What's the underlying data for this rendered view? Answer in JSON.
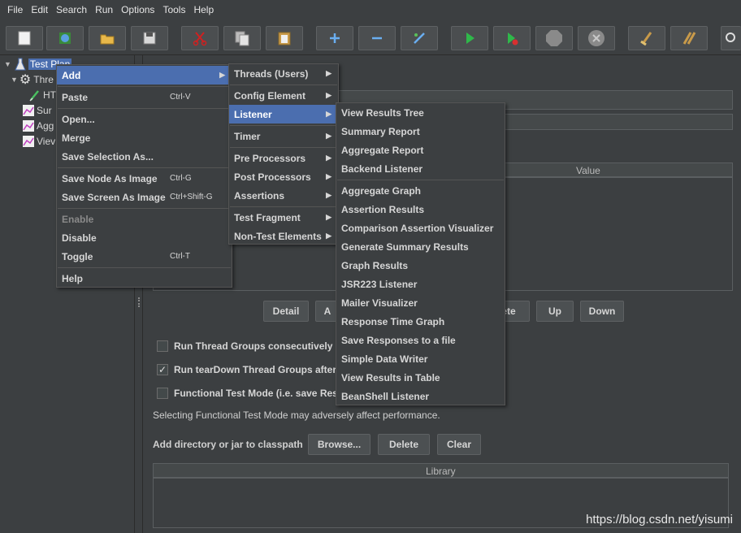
{
  "menubar": {
    "items": [
      {
        "label": "File"
      },
      {
        "label": "Edit"
      },
      {
        "label": "Search"
      },
      {
        "label": "Run"
      },
      {
        "label": "Options"
      },
      {
        "label": "Tools"
      },
      {
        "label": "Help"
      }
    ]
  },
  "toolbar": {
    "buttons": [
      {
        "icon": "new-icon"
      },
      {
        "icon": "templates-icon"
      },
      {
        "icon": "open-icon"
      },
      {
        "icon": "save-icon"
      },
      {
        "icon": "cut-icon"
      },
      {
        "icon": "copy-icon"
      },
      {
        "icon": "paste-icon"
      },
      {
        "icon": "expand-icon"
      },
      {
        "icon": "collapse-icon"
      },
      {
        "icon": "toggle-icon"
      },
      {
        "icon": "start-icon"
      },
      {
        "icon": "start-no-pauses-icon"
      },
      {
        "icon": "stop-icon"
      },
      {
        "icon": "shutdown-icon"
      },
      {
        "icon": "clear-icon"
      },
      {
        "icon": "clear-all-icon"
      },
      {
        "icon": "search-icon"
      }
    ]
  },
  "tree": {
    "items": [
      {
        "label": "Test Plan",
        "icon": "flask-icon"
      },
      {
        "label": "Thre",
        "icon": "gear-icon"
      },
      {
        "label": "HT",
        "icon": "pipette-icon"
      },
      {
        "label": "Sur",
        "icon": "graph-icon"
      },
      {
        "label": "Agg",
        "icon": "graph-icon"
      },
      {
        "label": "Viev",
        "icon": "graph-icon"
      }
    ]
  },
  "context_menu": {
    "items": [
      {
        "label": "Add",
        "shortcut": ""
      },
      {
        "label": "Paste",
        "shortcut": "Ctrl-V"
      },
      {
        "label": "Open...",
        "shortcut": ""
      },
      {
        "label": "Merge",
        "shortcut": ""
      },
      {
        "label": "Save Selection As...",
        "shortcut": ""
      },
      {
        "label": "Save Node As Image",
        "shortcut": "Ctrl-G"
      },
      {
        "label": "Save Screen As Image",
        "shortcut": "Ctrl+Shift-G"
      },
      {
        "label": "Enable",
        "shortcut": ""
      },
      {
        "label": "Disable",
        "shortcut": ""
      },
      {
        "label": "Toggle",
        "shortcut": "Ctrl-T"
      },
      {
        "label": "Help",
        "shortcut": ""
      }
    ]
  },
  "add_submenu": {
    "items": [
      {
        "label": "Threads (Users)"
      },
      {
        "label": "Config Element"
      },
      {
        "label": "Listener"
      },
      {
        "label": "Timer"
      },
      {
        "label": "Pre Processors"
      },
      {
        "label": "Post Processors"
      },
      {
        "label": "Assertions"
      },
      {
        "label": "Test Fragment"
      },
      {
        "label": "Non-Test Elements"
      }
    ]
  },
  "listener_submenu": {
    "items": [
      {
        "label": "View Results Tree"
      },
      {
        "label": "Summary Report"
      },
      {
        "label": "Aggregate Report"
      },
      {
        "label": "Backend Listener"
      },
      {
        "label": "Aggregate Graph"
      },
      {
        "label": "Assertion Results"
      },
      {
        "label": "Comparison Assertion Visualizer"
      },
      {
        "label": "Generate Summary Results"
      },
      {
        "label": "Graph Results"
      },
      {
        "label": "JSR223 Listener"
      },
      {
        "label": "Mailer Visualizer"
      },
      {
        "label": "Response Time Graph"
      },
      {
        "label": "Save Responses to a file"
      },
      {
        "label": "Simple Data Writer"
      },
      {
        "label": "View Results in Table"
      },
      {
        "label": "BeanShell Listener"
      }
    ]
  },
  "variables_table": {
    "value_header": "Value"
  },
  "table_buttons": {
    "detail": "Detail",
    "add_partial": "A",
    "delete_partial": "ete",
    "up": "Up",
    "down": "Down"
  },
  "options": {
    "run_consecutively": "Run Thread Groups consecutively (i",
    "run_teardown": "Run tearDown Thread Groups after",
    "functional_mode": "Functional Test Mode (i.e. save Res",
    "functional_note": "Selecting Functional Test Mode may adversely affect performance."
  },
  "classpath": {
    "label": "Add directory or jar to classpath",
    "browse": "Browse...",
    "delete": "Delete",
    "clear": "Clear",
    "library_header": "Library"
  },
  "watermark": "https://blog.csdn.net/yisumi",
  "colors": {
    "background": "#3c3f41",
    "highlight": "#4b6eaf",
    "text": "#d6d6d6"
  }
}
